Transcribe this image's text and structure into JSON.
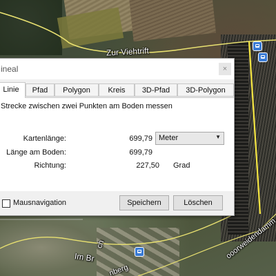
{
  "map": {
    "street_labels": [
      "Zur Viehtrift",
      "Im Br",
      "ch",
      "ooorweidendamm",
      "nberg"
    ],
    "measure_line_color": "#f5e642",
    "road_color": "#e8e070",
    "icons": [
      "train-station-icon",
      "train-station-icon",
      "train-station-icon"
    ]
  },
  "dialog": {
    "title": "ineal",
    "close_label": "×",
    "tabs": [
      "Linie",
      "Pfad",
      "Polygon",
      "Kreis",
      "3D-Pfad",
      "3D-Polygon"
    ],
    "active_tab": "Linie",
    "description": "Strecke zwischen zwei Punkten am Boden messen",
    "map_length_label": "Kartenlänge:",
    "map_length_value": "699,79",
    "unit_selected": "Meter",
    "ground_length_label": "Länge am Boden:",
    "ground_length_value": "699,79",
    "heading_label": "Richtung:",
    "heading_value": "227,50",
    "heading_unit": "Grad",
    "mouse_nav_label": "Mausnavigation",
    "mouse_nav_checked": false,
    "save_label": "Speichern",
    "delete_label": "Löschen"
  }
}
